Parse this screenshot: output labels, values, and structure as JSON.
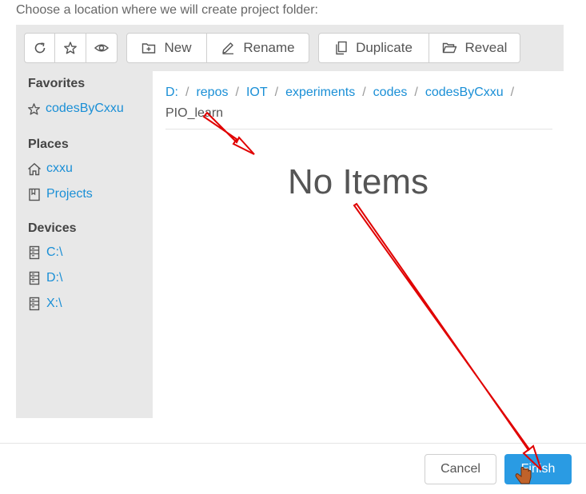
{
  "dialog": {
    "prompt": "Choose a location where we will create project folder:"
  },
  "toolbar": {
    "refresh_icon": "refresh-icon",
    "favorite_icon": "star-icon",
    "visibility_icon": "eye-icon",
    "new_label": "New",
    "rename_label": "Rename",
    "duplicate_label": "Duplicate",
    "reveal_label": "Reveal"
  },
  "sidebar": {
    "favorites_title": "Favorites",
    "favorites": [
      {
        "label": "codesByCxxu",
        "icon": "star-icon"
      }
    ],
    "places_title": "Places",
    "places": [
      {
        "label": "cxxu",
        "icon": "home-icon"
      },
      {
        "label": "Projects",
        "icon": "bookmark-icon"
      }
    ],
    "devices_title": "Devices",
    "devices": [
      {
        "label": "C:\\",
        "icon": "drive-icon"
      },
      {
        "label": "D:\\",
        "icon": "drive-icon"
      },
      {
        "label": "X:\\",
        "icon": "drive-icon"
      }
    ]
  },
  "breadcrumb": {
    "items": [
      "D:",
      "repos",
      "IOT",
      "experiments",
      "codes",
      "codesByCxxu"
    ],
    "separator": "/",
    "current": "PIO_learn"
  },
  "main": {
    "empty_message": "No Items"
  },
  "footer": {
    "cancel_label": "Cancel",
    "finish_label": "Finish"
  },
  "colors": {
    "accent": "#2a9be3",
    "link": "#1a8fd6",
    "annotation": "#e00000",
    "cursor": "#c0622a"
  }
}
